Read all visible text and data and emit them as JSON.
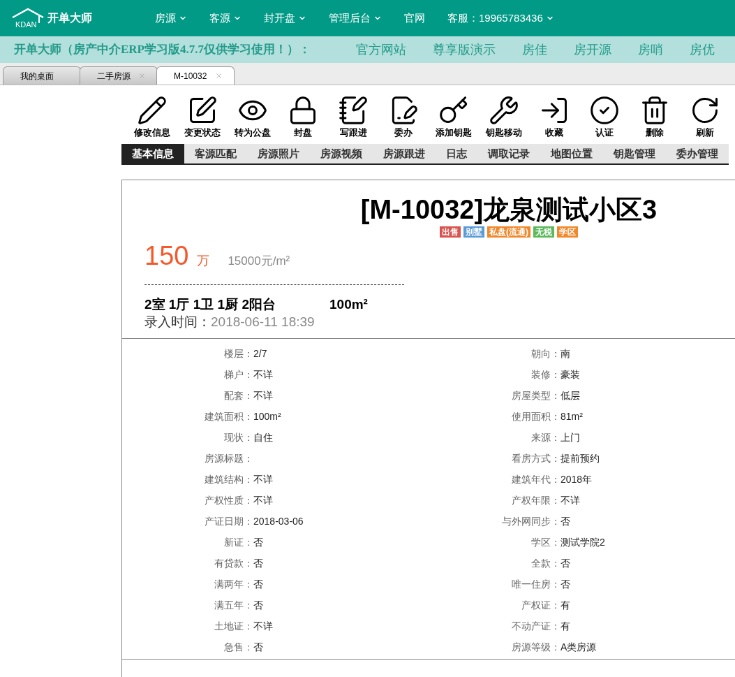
{
  "header": {
    "logo_mark": "KDAN",
    "logo_text": "开单大师",
    "menu": [
      {
        "label": "房源",
        "dropdown": true
      },
      {
        "label": "客源",
        "dropdown": true
      },
      {
        "label": "封开盘",
        "dropdown": true
      },
      {
        "label": "管理后台",
        "dropdown": true
      },
      {
        "label": "官网",
        "dropdown": false
      },
      {
        "label": "客服：19965783436",
        "dropdown": true
      }
    ]
  },
  "banner": {
    "text": "开单大师（房产中介ERP学习版4.7.7仅供学习使用！）：",
    "links": [
      "官方网站",
      "尊享版演示",
      "房佳",
      "房开源",
      "房哨",
      "房优"
    ]
  },
  "tabs": [
    {
      "label": "我的桌面",
      "selected": false,
      "closable": false
    },
    {
      "label": "二手房源",
      "selected": false,
      "closable": true
    },
    {
      "label": "M-10032",
      "selected": true,
      "closable": true
    }
  ],
  "toolbar": [
    "修改信息",
    "变更状态",
    "转为公盘",
    "封盘",
    "写跟进",
    "委办",
    "添加钥匙",
    "钥匙移动",
    "收藏",
    "认证",
    "删除",
    "刷新"
  ],
  "subtabs": [
    {
      "label": "基本信息",
      "selected": true
    },
    {
      "label": "客源匹配",
      "selected": false
    },
    {
      "label": "房源照片",
      "selected": false
    },
    {
      "label": "房源视频",
      "selected": false
    },
    {
      "label": "房源跟进",
      "selected": false
    },
    {
      "label": "日志",
      "selected": false
    },
    {
      "label": "调取记录",
      "selected": false
    },
    {
      "label": "地图位置",
      "selected": false
    },
    {
      "label": "钥匙管理",
      "selected": false
    },
    {
      "label": "委办管理",
      "selected": false
    }
  ],
  "listing": {
    "title": "[M-10032]龙泉测试小区3",
    "tags": [
      {
        "label": "出售",
        "color": "#d9534f"
      },
      {
        "label": "别墅",
        "color": "#5b9bd5"
      },
      {
        "label": "私盘(流通)",
        "color": "#f0882c"
      },
      {
        "label": "无税",
        "color": "#5cb85c"
      },
      {
        "label": "学区",
        "color": "#f0882c"
      }
    ],
    "price": "150",
    "price_unit": "万",
    "unit_price": "15000元/m²",
    "layout": "2室 1厅 1卫 1厨 2阳台",
    "area": "100m²",
    "entry_label": "录入时间：",
    "entry_time": "2018-06-11 18:39"
  },
  "details": [
    {
      "left": {
        "label": "楼层：",
        "value": "2/7"
      },
      "right": {
        "label": "朝向：",
        "value": "南"
      }
    },
    {
      "left": {
        "label": "梯户：",
        "value": "不详"
      },
      "right": {
        "label": "装修：",
        "value": "豪装"
      }
    },
    {
      "left": {
        "label": "配套：",
        "value": "不详"
      },
      "right": {
        "label": "房屋类型：",
        "value": "低层"
      }
    },
    {
      "left": {
        "label": "建筑面积：",
        "value": "100m²"
      },
      "right": {
        "label": "使用面积：",
        "value": "81m²"
      }
    },
    {
      "left": {
        "label": "现状：",
        "value": "自住"
      },
      "right": {
        "label": "来源：",
        "value": "上门"
      }
    },
    {
      "left": {
        "label": "房源标题："
      },
      "right": {
        "label": "看房方式：",
        "value": "提前预约"
      }
    },
    {
      "left": {
        "label": "建筑结构：",
        "value": "不详"
      },
      "right": {
        "label": "建筑年代：",
        "value": "2018年"
      }
    },
    {
      "left": {
        "label": "产权性质：",
        "value": "不详"
      },
      "right": {
        "label": "产权年限：",
        "value": "不详"
      }
    },
    {
      "left": {
        "label": "产证日期：",
        "value": "2018-03-06"
      },
      "right": {
        "label": "与外网同步：",
        "value": "否"
      }
    },
    {
      "left": {
        "label": "新证：",
        "value": "否"
      },
      "right": {
        "label": "学区：",
        "value": "测试学院2"
      }
    },
    {
      "left": {
        "label": "有贷款：",
        "value": "否"
      },
      "right": {
        "label": "全款：",
        "value": "否"
      }
    },
    {
      "left": {
        "label": "满两年：",
        "value": "否"
      },
      "right": {
        "label": "唯一住房：",
        "value": "否"
      }
    },
    {
      "left": {
        "label": "满五年：",
        "value": "否"
      },
      "right": {
        "label": "产权证：",
        "value": "有"
      }
    },
    {
      "left": {
        "label": "土地证：",
        "value": "不详"
      },
      "right": {
        "label": "不动产证：",
        "value": "有"
      }
    },
    {
      "left": {
        "label": "急售：",
        "value": "否"
      },
      "right": {
        "label": "房源等级：",
        "value": "A类房源"
      }
    }
  ]
}
